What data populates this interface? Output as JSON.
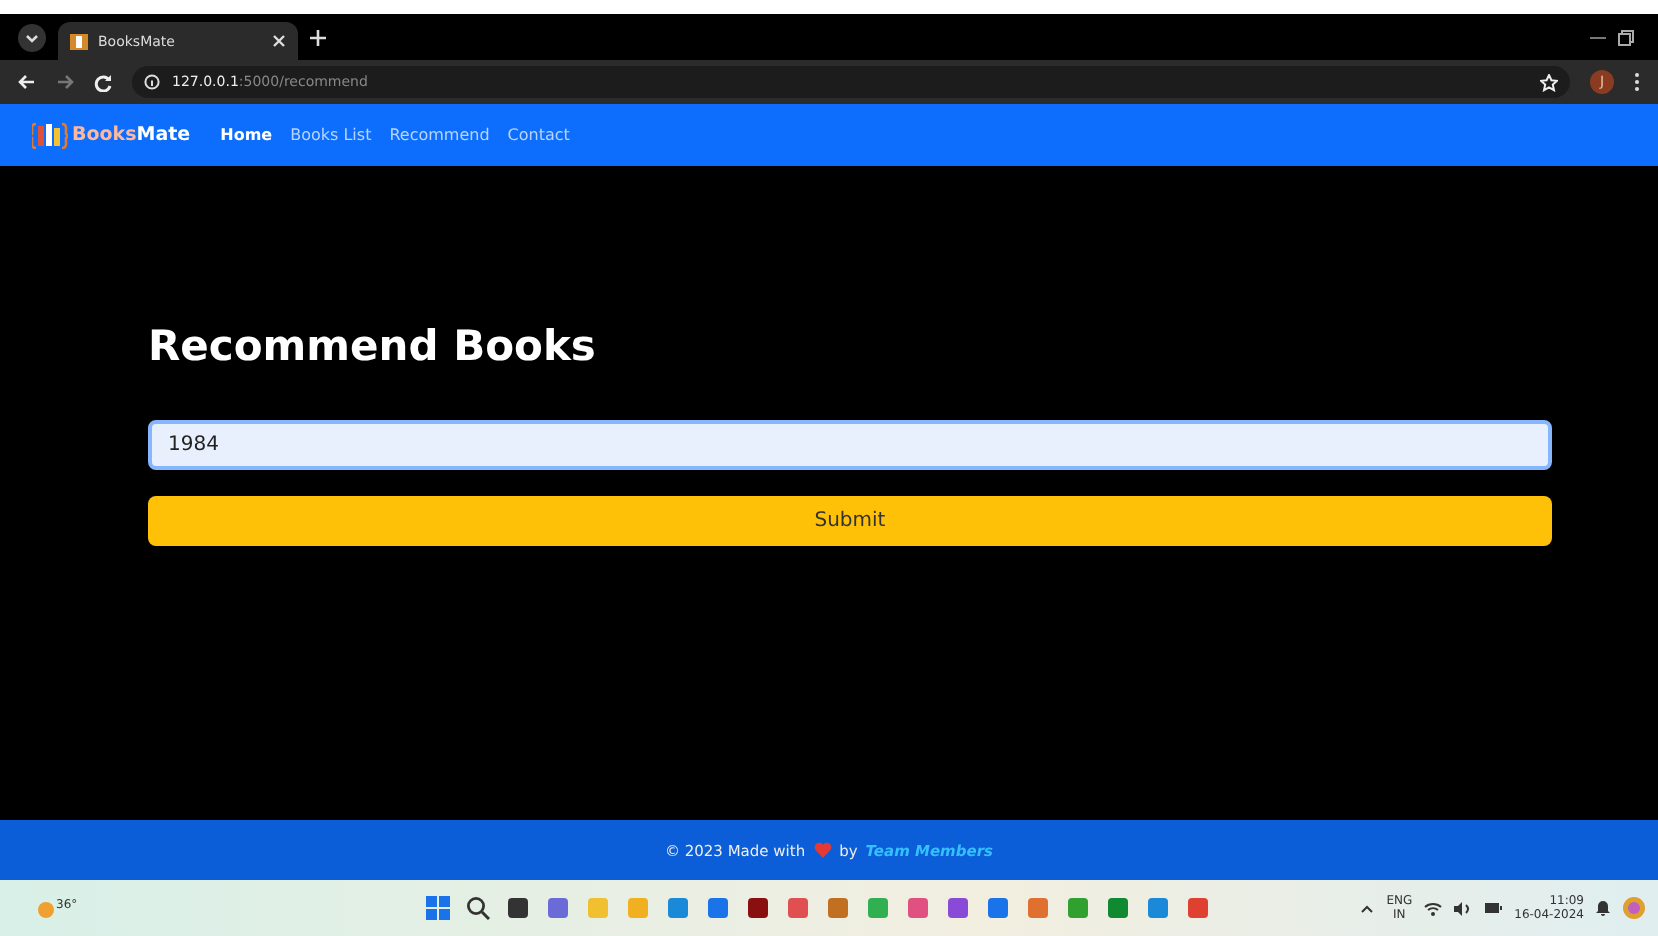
{
  "browser": {
    "tab_title": "BooksMate",
    "url_host": "127.0.0.1",
    "url_path": ":5000/recommend",
    "profile_initial": "J"
  },
  "navbar": {
    "brand_first": "Books",
    "brand_second": "Mate",
    "links": [
      {
        "label": "Home",
        "selected": true
      },
      {
        "label": "Books List",
        "selected": false
      },
      {
        "label": "Recommend",
        "selected": false
      },
      {
        "label": "Contact",
        "selected": false
      }
    ]
  },
  "form": {
    "title": "Recommend Books",
    "input_value": "1984",
    "submit": "Submit"
  },
  "footer": {
    "text_before": "© 2023 Made with",
    "text_by": "by",
    "link": "Team Members"
  },
  "taskbar": {
    "weather": "36°",
    "language": "ENG",
    "region": "IN",
    "time": "11:09",
    "date": "16-04-2024"
  }
}
